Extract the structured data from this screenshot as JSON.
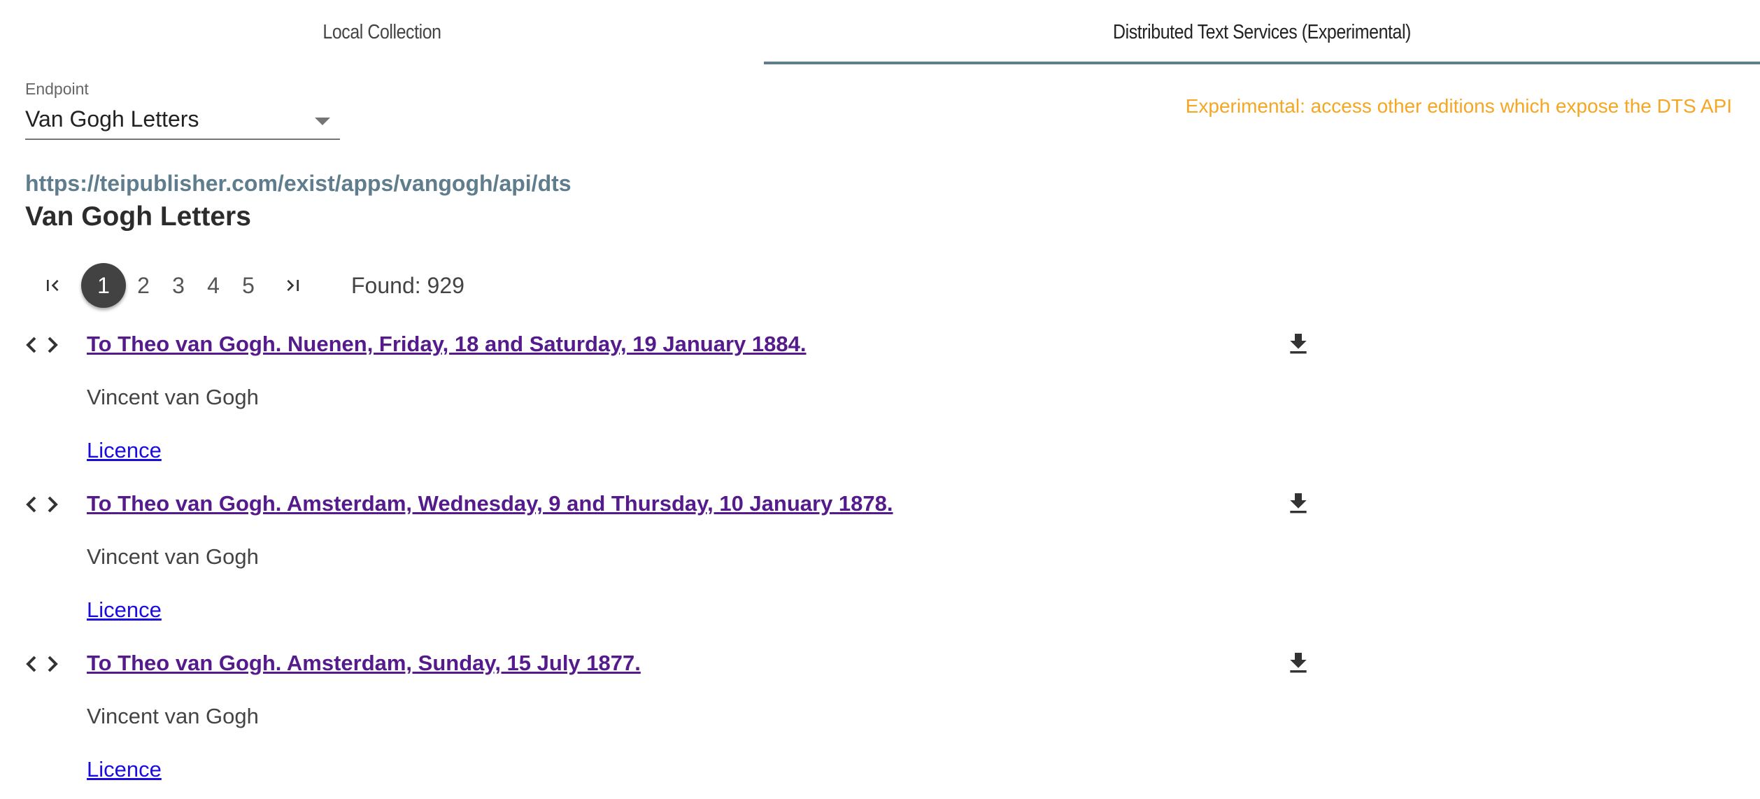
{
  "tabs": [
    {
      "label": "Local Collection",
      "active": false
    },
    {
      "label": "Distributed Text Services (Experimental)",
      "active": true
    }
  ],
  "endpoint": {
    "label": "Endpoint",
    "selected": "Van Gogh Letters",
    "url": "https://teipublisher.com/exist/apps/vangogh/api/dts"
  },
  "experimental_note": "Experimental: access other editions which expose the DTS API",
  "collection_title": "Van Gogh Letters",
  "pagination": {
    "first_icon": "first-page-icon",
    "last_icon": "last-page-icon",
    "current": "1",
    "pages": [
      "2",
      "3",
      "4",
      "5"
    ],
    "found": "Found: 929"
  },
  "documents": [
    {
      "title": "To Theo van Gogh. Nuenen, Friday, 18 and Saturday, 19 January 1884.",
      "author": "Vincent van Gogh",
      "licence": "Licence"
    },
    {
      "title": "To Theo van Gogh. Amsterdam, Wednesday, 9 and Thursday, 10 January 1878.",
      "author": "Vincent van Gogh",
      "licence": "Licence"
    },
    {
      "title": "To Theo van Gogh. Amsterdam, Sunday, 15 July 1877.",
      "author": "Vincent van Gogh",
      "licence": "Licence"
    }
  ],
  "colors": {
    "tab_indicator": "#607d8b",
    "experimental": "#f5a623",
    "url": "#5f7d8c",
    "visited_link": "#551a8b",
    "link": "#1a0dde",
    "current_page_bg": "#424242"
  }
}
